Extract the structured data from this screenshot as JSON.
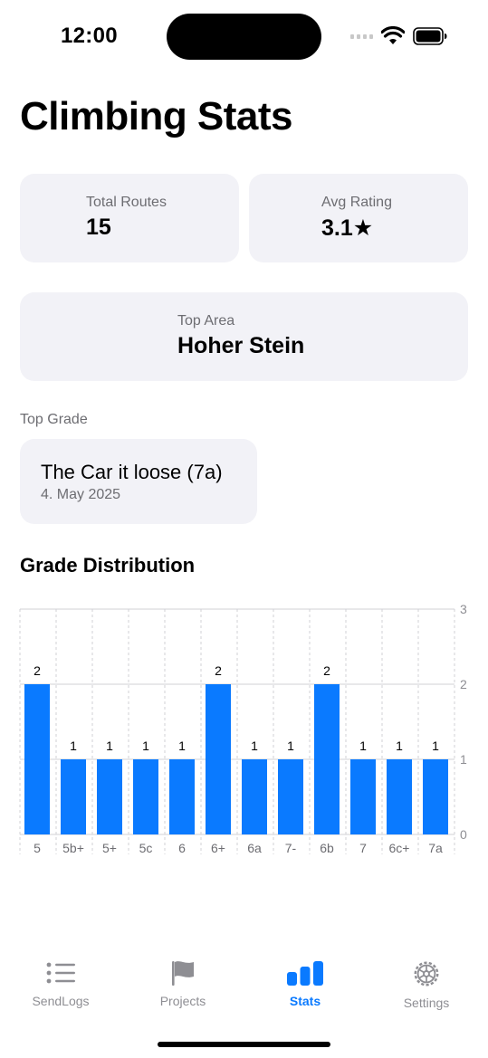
{
  "status_bar": {
    "time": "12:00"
  },
  "page": {
    "title": "Climbing Stats"
  },
  "summary": {
    "total_routes_label": "Total Routes",
    "total_routes_value": "15",
    "avg_rating_label": "Avg Rating",
    "avg_rating_value": "3.1★",
    "top_area_label": "Top Area",
    "top_area_value": "Hoher Stein"
  },
  "top_grade": {
    "section_label": "Top Grade",
    "route": "The Car it loose (7a)",
    "date": "4. May 2025"
  },
  "chart_data": {
    "type": "bar",
    "title": "Grade Distribution",
    "categories": [
      "5",
      "5b+",
      "5+",
      "5c",
      "6",
      "6+",
      "6a",
      "7-",
      "6b",
      "7",
      "6c+",
      "7a"
    ],
    "values": [
      2,
      1,
      1,
      1,
      1,
      2,
      1,
      1,
      2,
      1,
      1,
      1
    ],
    "ylim": [
      0,
      3
    ],
    "yticks": [
      0,
      1,
      2,
      3
    ],
    "bar_color": "#0a7aff",
    "grid": true
  },
  "tab_bar": {
    "tabs": [
      {
        "label": "SendLogs",
        "icon": "list-icon",
        "active": false
      },
      {
        "label": "Projects",
        "icon": "flag-icon",
        "active": false
      },
      {
        "label": "Stats",
        "icon": "bar-chart-icon",
        "active": true
      },
      {
        "label": "Settings",
        "icon": "gear-icon",
        "active": false
      }
    ]
  }
}
